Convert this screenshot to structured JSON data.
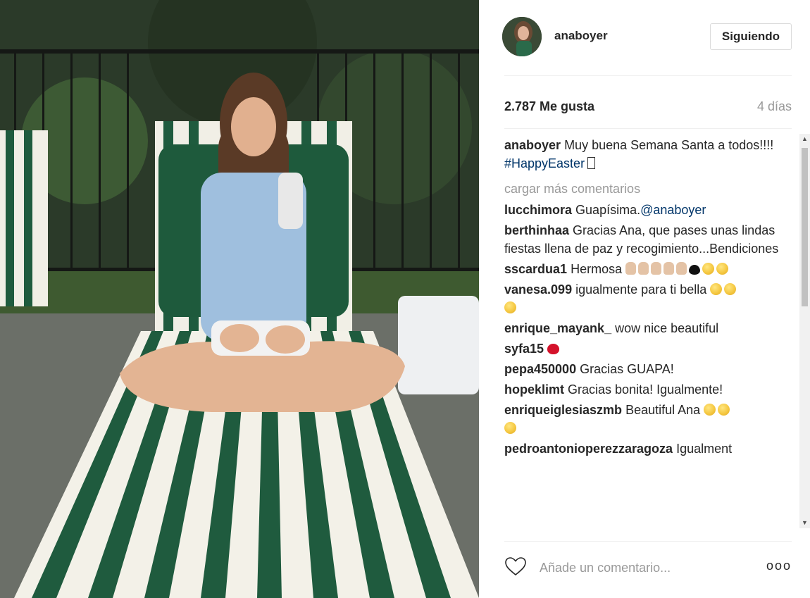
{
  "photo": {
    "alt_icon": "photo-poolside-lounger"
  },
  "post": {
    "username": "anaboyer",
    "follow_label": "Siguiendo",
    "likes": "2.787 Me gusta",
    "time_ago": "4 días",
    "caption_user": "anaboyer",
    "caption_text": "Muy buena Semana Santa a todos!!!!",
    "caption_hashtag": "#HappyEaster",
    "load_more": "cargar más comentarios"
  },
  "comments": [
    {
      "user": "lucchimora",
      "text": "Guapísima.",
      "mention": "@anaboyer"
    },
    {
      "user": "berthinhaa",
      "text": "Gracias Ana, que pases unas lindas fiestas llena de paz y recogimiento...Bendiciones"
    },
    {
      "user": "sscardua1",
      "text": "Hermosa"
    },
    {
      "user": "vanesa.099",
      "text": "igualmente para ti bella"
    },
    {
      "user": "enrique_mayank_",
      "text": "wow nice beautiful"
    },
    {
      "user": "syfa15",
      "text": ""
    },
    {
      "user": "pepa450000",
      "text": "Gracias GUAPA!"
    },
    {
      "user": "hopeklimt",
      "text": "Gracias bonita! Igualmente!"
    },
    {
      "user": "enriqueiglesiaszmb",
      "text": "Beautiful Ana"
    },
    {
      "user": "pedroantonioperezzaragoza",
      "text": "Igualment"
    }
  ],
  "add_comment": {
    "placeholder": "Añade un comentario...",
    "more": "ooo"
  },
  "colors": {
    "link": "#003569",
    "muted": "#999999",
    "text": "#262626"
  }
}
